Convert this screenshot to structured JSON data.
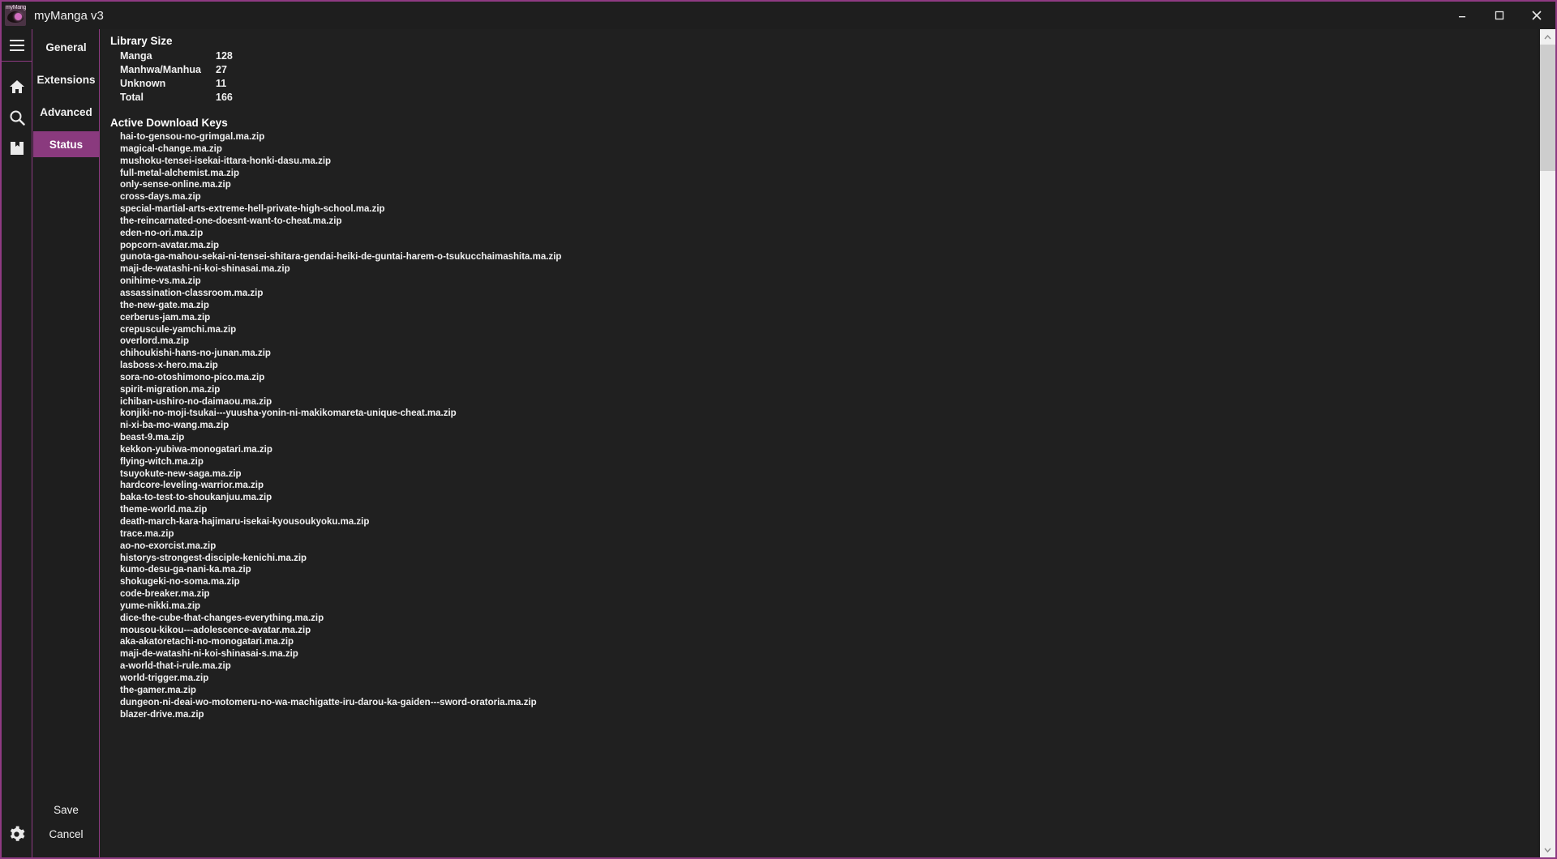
{
  "window": {
    "title": "myManga v3",
    "logo_text": "myManga",
    "controls": {
      "minimize": "minimize-icon",
      "maximize": "maximize-icon",
      "close": "close-icon"
    },
    "accent_color": "#8e3a82",
    "background_color": "#1e1e1e",
    "content_background": "#202020",
    "text_color": "#f0f0f0"
  },
  "rail": {
    "items": [
      {
        "icon": "hamburger-menu-icon",
        "name": "menu"
      },
      {
        "icon": "home-icon",
        "name": "home"
      },
      {
        "icon": "search-icon",
        "name": "search"
      },
      {
        "icon": "bookmark-icon",
        "name": "library"
      }
    ],
    "bottom": {
      "icon": "gear-icon",
      "name": "settings"
    }
  },
  "tabs": {
    "items": [
      {
        "label": "General",
        "active": false
      },
      {
        "label": "Extensions",
        "active": false
      },
      {
        "label": "Advanced",
        "active": false
      },
      {
        "label": "Status",
        "active": true
      }
    ],
    "active_color": "#8a3a7e",
    "actions": {
      "save_label": "Save",
      "cancel_label": "Cancel"
    }
  },
  "library_size": {
    "title": "Library Size",
    "rows": [
      {
        "label": "Manga",
        "value": "128"
      },
      {
        "label": "Manhwa/Manhua",
        "value": "27"
      },
      {
        "label": "Unknown",
        "value": "11"
      },
      {
        "label": "Total",
        "value": "166"
      }
    ]
  },
  "active_download_keys": {
    "title": "Active Download Keys",
    "items": [
      "hai-to-gensou-no-grimgal.ma.zip",
      "magical-change.ma.zip",
      "mushoku-tensei-isekai-ittara-honki-dasu.ma.zip",
      "full-metal-alchemist.ma.zip",
      "only-sense-online.ma.zip",
      "cross-days.ma.zip",
      "special-martial-arts-extreme-hell-private-high-school.ma.zip",
      "the-reincarnated-one-doesnt-want-to-cheat.ma.zip",
      "eden-no-ori.ma.zip",
      "popcorn-avatar.ma.zip",
      "gunota-ga-mahou-sekai-ni-tensei-shitara-gendai-heiki-de-guntai-harem-o-tsukucchaimashita.ma.zip",
      "maji-de-watashi-ni-koi-shinasai.ma.zip",
      "onihime-vs.ma.zip",
      "assassination-classroom.ma.zip",
      "the-new-gate.ma.zip",
      "cerberus-jam.ma.zip",
      "crepuscule-yamchi.ma.zip",
      "overlord.ma.zip",
      "chihoukishi-hans-no-junan.ma.zip",
      "lasboss-x-hero.ma.zip",
      "sora-no-otoshimono-pico.ma.zip",
      "spirit-migration.ma.zip",
      "ichiban-ushiro-no-daimaou.ma.zip",
      "konjiki-no-moji-tsukai---yuusha-yonin-ni-makikomareta-unique-cheat.ma.zip",
      "ni-xi-ba-mo-wang.ma.zip",
      "beast-9.ma.zip",
      "kekkon-yubiwa-monogatari.ma.zip",
      "flying-witch.ma.zip",
      "tsuyokute-new-saga.ma.zip",
      "hardcore-leveling-warrior.ma.zip",
      "baka-to-test-to-shoukanjuu.ma.zip",
      "theme-world.ma.zip",
      "death-march-kara-hajimaru-isekai-kyousoukyoku.ma.zip",
      "trace.ma.zip",
      "ao-no-exorcist.ma.zip",
      "historys-strongest-disciple-kenichi.ma.zip",
      "kumo-desu-ga-nani-ka.ma.zip",
      "shokugeki-no-soma.ma.zip",
      "code-breaker.ma.zip",
      "yume-nikki.ma.zip",
      "dice-the-cube-that-changes-everything.ma.zip",
      "mousou-kikou---adolescence-avatar.ma.zip",
      "aka-akatoretachi-no-monogatari.ma.zip",
      "maji-de-watashi-ni-koi-shinasai-s.ma.zip",
      "a-world-that-i-rule.ma.zip",
      "world-trigger.ma.zip",
      "the-gamer.ma.zip",
      "dungeon-ni-deai-wo-motomeru-no-wa-machigatte-iru-darou-ka-gaiden---sword-oratoria.ma.zip",
      "blazer-drive.ma.zip"
    ]
  },
  "scrollbar": {
    "up_arrow": "chevron-up-icon",
    "down_arrow": "chevron-down-icon",
    "thumb_color": "#cdcdcd",
    "track_color": "#f0f0f0"
  }
}
